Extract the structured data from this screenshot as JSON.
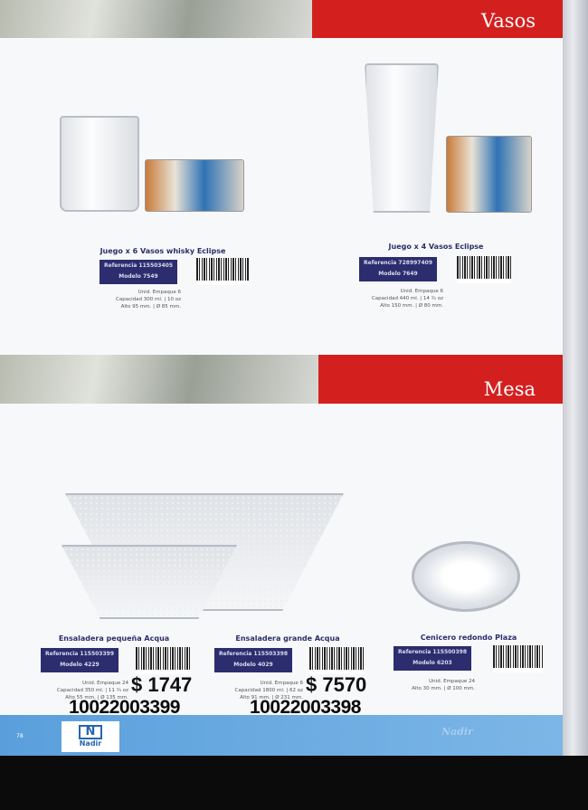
{
  "sections": {
    "vasos": "Vasos",
    "mesa": "Mesa"
  },
  "products": [
    {
      "title": "Juego x 6 Vasos whisky Eclipse",
      "referencia": "Referencia 115503405",
      "modelo": "Modelo 7549",
      "unid": "Unid. Empaque 6",
      "capacidad": "Capacidad 300 ml. | 10 oz",
      "alto": "Alto 95 mm. | Ø 85 mm."
    },
    {
      "title": "Juego x 4 Vasos Eclipse",
      "referencia": "Referencia 728997409",
      "modelo": "Modelo 7649",
      "unid": "Unid. Empaque 6",
      "capacidad": "Capacidad 440 ml. | 14 ¾ oz",
      "alto": "Alto 150 mm. | Ø 80 mm."
    },
    {
      "title": "Ensaladera pequeña Acqua",
      "referencia": "Referencia 115503399",
      "modelo": "Modelo 4229",
      "unid": "Unid. Empaque 24",
      "capacidad": "Capacidad 350 ml. | 11 ¾ oz",
      "alto": "Alto 55 mm. | Ø 135 mm.",
      "price": "$ 1747",
      "code": "10022003399"
    },
    {
      "title": "Ensaladera grande Acqua",
      "referencia": "Referencia 115503398",
      "modelo": "Modelo 4029",
      "unid": "Unid. Empaque 6",
      "capacidad": "Capacidad 1800 ml. | 62 oz",
      "alto": "Alto 91 mm. | Ø 231 mm.",
      "price": "$ 7570",
      "code": "10022003398"
    },
    {
      "title": "Cenicero redondo Plaza",
      "referencia": "Referencia 115500398",
      "modelo": "Modelo 6203",
      "unid": "Unid. Empaque 24",
      "alto": "Alto 30 mm. | Ø 100 mm."
    }
  ],
  "footer": {
    "page": "78",
    "logo": "Nadir",
    "brand": "Nadir"
  }
}
